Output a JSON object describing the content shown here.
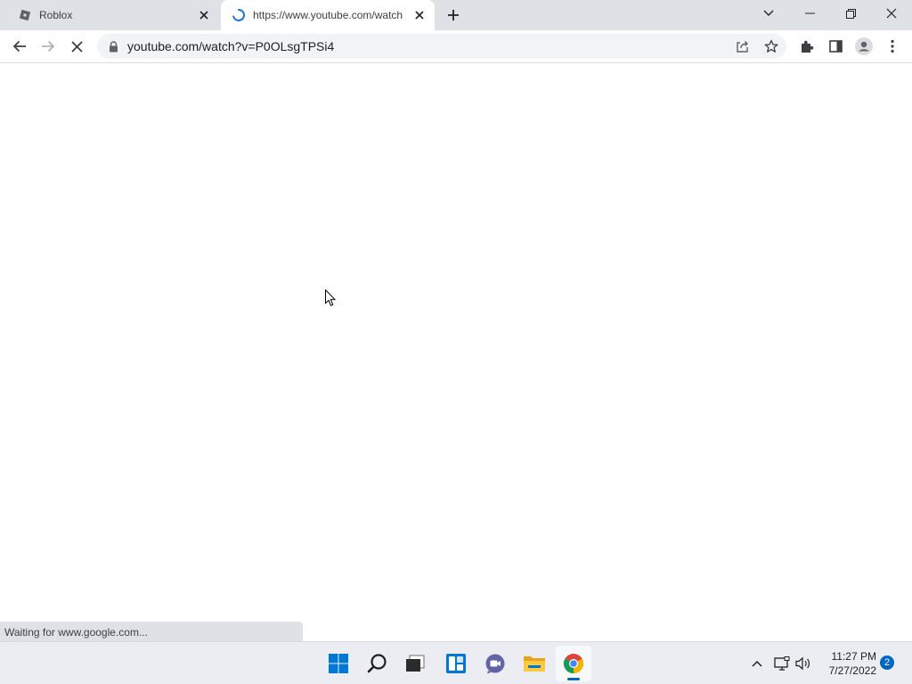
{
  "tabs": [
    {
      "title": "Roblox",
      "favicon": "roblox-icon",
      "active": false
    },
    {
      "title": "https://www.youtube.com/watch",
      "favicon": "loading-spinner-icon",
      "active": true
    }
  ],
  "toolbar": {
    "url": "youtube.com/watch?v=P0OLsgTPSi4"
  },
  "status_bubble": "Waiting for www.google.com...",
  "taskbar": {
    "time": "11:27 PM",
    "date": "7/27/2022",
    "notification_count": "2"
  },
  "colors": {
    "accent": "#0067c0",
    "tab_strip": "#dee1e6",
    "omnibox": "#f1f3f4"
  }
}
